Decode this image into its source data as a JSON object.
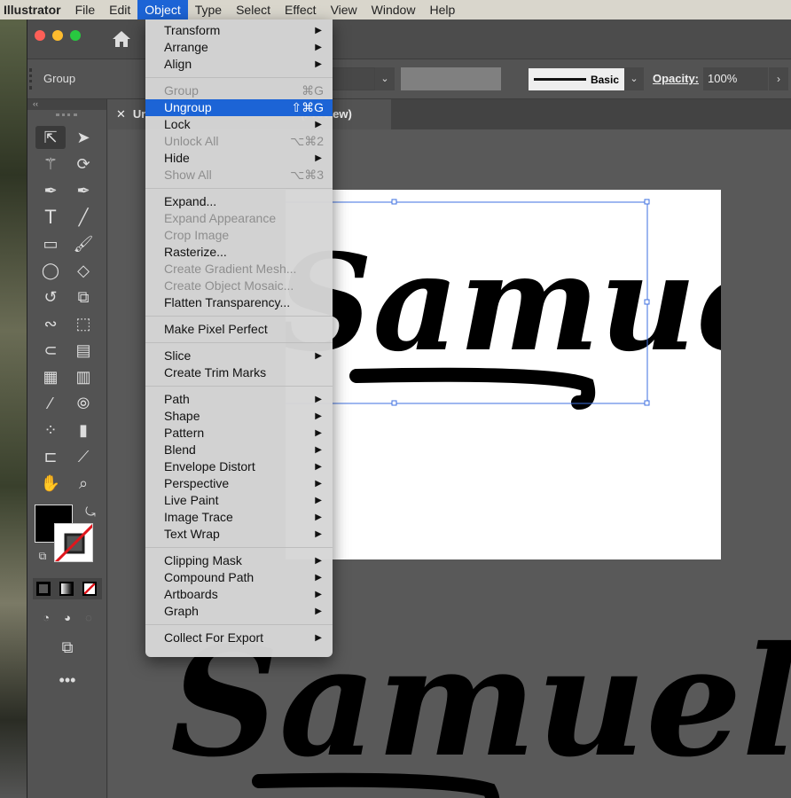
{
  "menubar": {
    "app": "Illustrator",
    "items": [
      "File",
      "Edit",
      "Object",
      "Type",
      "Select",
      "Effect",
      "View",
      "Window",
      "Help"
    ],
    "active": "Object"
  },
  "control_bar": {
    "selection": "Group",
    "stroke_style": "Basic",
    "opacity_label": "Opacity:",
    "opacity_value": "100%"
  },
  "document_tab": {
    "title": "Un",
    "suffix": "(Preview)"
  },
  "artwork_text": "Samuel",
  "object_menu": {
    "groups": [
      [
        {
          "label": "Transform",
          "submenu": true
        },
        {
          "label": "Arrange",
          "submenu": true
        },
        {
          "label": "Align",
          "submenu": true
        }
      ],
      [
        {
          "label": "Group",
          "shortcut": "⌘G",
          "disabled": true
        },
        {
          "label": "Ungroup",
          "shortcut": "⇧⌘G",
          "highlighted": true
        },
        {
          "label": "Lock",
          "submenu": true
        },
        {
          "label": "Unlock All",
          "shortcut": "⌥⌘2",
          "disabled": true
        },
        {
          "label": "Hide",
          "submenu": true
        },
        {
          "label": "Show All",
          "shortcut": "⌥⌘3",
          "disabled": true
        }
      ],
      [
        {
          "label": "Expand..."
        },
        {
          "label": "Expand Appearance",
          "disabled": true
        },
        {
          "label": "Crop Image",
          "disabled": true
        },
        {
          "label": "Rasterize..."
        },
        {
          "label": "Create Gradient Mesh...",
          "disabled": true
        },
        {
          "label": "Create Object Mosaic...",
          "disabled": true
        },
        {
          "label": "Flatten Transparency..."
        }
      ],
      [
        {
          "label": "Make Pixel Perfect"
        }
      ],
      [
        {
          "label": "Slice",
          "submenu": true
        },
        {
          "label": "Create Trim Marks"
        }
      ],
      [
        {
          "label": "Path",
          "submenu": true
        },
        {
          "label": "Shape",
          "submenu": true
        },
        {
          "label": "Pattern",
          "submenu": true
        },
        {
          "label": "Blend",
          "submenu": true
        },
        {
          "label": "Envelope Distort",
          "submenu": true
        },
        {
          "label": "Perspective",
          "submenu": true
        },
        {
          "label": "Live Paint",
          "submenu": true
        },
        {
          "label": "Image Trace",
          "submenu": true
        },
        {
          "label": "Text Wrap",
          "submenu": true
        }
      ],
      [
        {
          "label": "Clipping Mask",
          "submenu": true
        },
        {
          "label": "Compound Path",
          "submenu": true
        },
        {
          "label": "Artboards",
          "submenu": true
        },
        {
          "label": "Graph",
          "submenu": true
        }
      ],
      [
        {
          "label": "Collect For Export",
          "submenu": true
        }
      ]
    ]
  },
  "colors": {
    "accent": "#1c64d6",
    "fill": "#000000",
    "selection": "#3d6fe0"
  }
}
